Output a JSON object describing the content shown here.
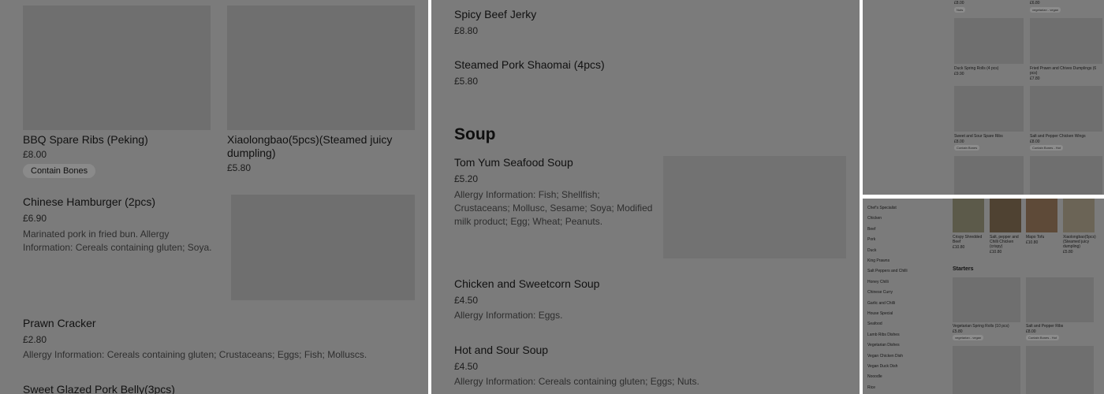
{
  "panel1": {
    "items": [
      {
        "name": "BBQ Spare Ribs (Peking)",
        "price": "£8.00",
        "badge": "Contain Bones"
      },
      {
        "name": "Xiaolongbao(5pcs)(Steamed juicy dumpling)",
        "price": "£5.80"
      },
      {
        "name": "Chinese Hamburger (2pcs)",
        "price": "£6.90",
        "desc": "Marinated pork in fried bun. Allergy Information: Cereals containing gluten; Soya."
      },
      {
        "name": "Prawn Cracker",
        "price": "£2.80",
        "desc": "Allergy Information: Cereals containing gluten; Crustaceans; Eggs; Fish; Molluscs."
      },
      {
        "name": "Sweet Glazed Pork Belly(3pcs)"
      }
    ]
  },
  "panel2": {
    "items_top": [
      {
        "name": "Spicy Beef Jerky",
        "price": "£8.80"
      },
      {
        "name": "Steamed Pork Shaomai (4pcs)",
        "price": "£5.80"
      }
    ],
    "section": "Soup",
    "soups": [
      {
        "name": "Tom Yum Seafood Soup",
        "price": "£5.20",
        "desc": "Allergy Information: Fish; Shellfish; Crustaceans; Mollusc, Sesame; Soya; Modified milk product; Egg; Wheat; Peanuts."
      },
      {
        "name": "Chicken and Sweetcorn Soup",
        "price": "£4.50",
        "desc": "Allergy Information: Eggs."
      },
      {
        "name": "Hot and Sour Soup",
        "price": "£4.50",
        "desc": "Allergy Information: Cereals containing gluten; Eggs; Nuts."
      }
    ]
  },
  "panel3": {
    "tags": [
      "Nuts",
      "vegetarian - vegan"
    ],
    "items": [
      {
        "name": "Duck Spring Rolls (4 pcs)",
        "price": "£9.90"
      },
      {
        "name": "Fried Prawn and Chives Dumplings (6 pcs)",
        "price": "£7.80"
      },
      {
        "name": "Sweet and Sour Spare Ribs",
        "price": "£8.00",
        "badge": "Contain Bones"
      },
      {
        "name": "Salt and Pepper Chicken Wings",
        "price": "£8.00",
        "badge": "Contain Bones - Hot"
      }
    ]
  },
  "panel4": {
    "sidebar": [
      "Chef's Specialist",
      "Chicken",
      "Beef",
      "Pork",
      "Duck",
      "King Prawns",
      "Salt Peppers and Chilli",
      "Honey Chilli",
      "Chinese Curry",
      "Garlic and Chilli",
      "House Special",
      "Seafood",
      "Lamb Ribs Dishes",
      "Vegetarian Dishes",
      "Vegan Chicken Dish",
      "Vegan Duck Dish",
      "Nooodle",
      "Rice"
    ],
    "popular": [
      {
        "name": "Crispy Shredded Beef",
        "price": "£10.80"
      },
      {
        "name": "Salt, pepper and Chilli Chicken (crispy)",
        "price": "£10.80"
      },
      {
        "name": "Mapo Tofu",
        "price": "£10.80"
      },
      {
        "name": "Xiaolongbao(5pcs)(Steamed juicy dumpling)",
        "price": "£5.80"
      }
    ],
    "section": "Starters",
    "starters": [
      {
        "name": "Vegetarian Spring Rolls (10 pcs)",
        "price": "£5.80",
        "badge": "vegetarian - vegan"
      },
      {
        "name": "Salt and Pepper Ribs",
        "price": "£8.00",
        "badge": "Contain Bones - Hot"
      }
    ]
  }
}
